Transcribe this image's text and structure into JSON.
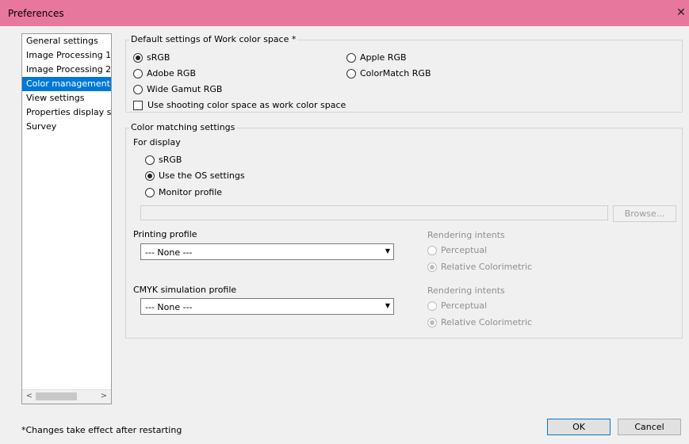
{
  "window": {
    "title": "Preferences",
    "close_glyph": "✕"
  },
  "sidebar": {
    "items": [
      {
        "label": "General settings"
      },
      {
        "label": "Image Processing 1"
      },
      {
        "label": "Image Processing 2"
      },
      {
        "label": "Color management",
        "selected": true
      },
      {
        "label": "View settings"
      },
      {
        "label": "Properties display sett"
      },
      {
        "label": "Survey"
      }
    ],
    "scroll_left": "<",
    "scroll_right": ">"
  },
  "work_space": {
    "legend": "Default settings of Work color space *",
    "options": {
      "srgb": "sRGB",
      "adobe": "Adobe RGB",
      "wide": "Wide Gamut RGB",
      "apple": "Apple RGB",
      "colormatch": "ColorMatch RGB"
    },
    "selected": "sRGB",
    "checkbox_label": "Use shooting color space as work color space",
    "checkbox_checked": false
  },
  "color_matching": {
    "legend": "Color matching settings",
    "for_display": "For display",
    "display_options": {
      "srgb": "sRGB",
      "os": "Use the OS settings",
      "monitor": "Monitor profile"
    },
    "display_selected": "Use the OS settings",
    "monitor_path_value": "",
    "browse_label": "Browse...",
    "printing_profile": {
      "label": "Printing profile",
      "value": "--- None ---",
      "intent_label": "Rendering intents",
      "intent_perceptual": "Perceptual",
      "intent_relative": "Relative Colorimetric",
      "intent_selected": "Relative Colorimetric"
    },
    "cmyk_profile": {
      "label": "CMYK simulation profile",
      "value": "--- None ---",
      "intent_label": "Rendering intents",
      "intent_perceptual": "Perceptual",
      "intent_relative": "Relative Colorimetric",
      "intent_selected": "Relative Colorimetric"
    }
  },
  "footer": {
    "note": "*Changes take effect after restarting",
    "ok_label": "OK",
    "cancel_label": "Cancel"
  },
  "colors": {
    "titlebar": "#e8779e",
    "selection": "#0078d7"
  },
  "icons": {
    "close": "close-icon",
    "dropdown": "chevron-down-icon",
    "scroll_left": "chevron-left-icon",
    "scroll_right": "chevron-right-icon"
  }
}
